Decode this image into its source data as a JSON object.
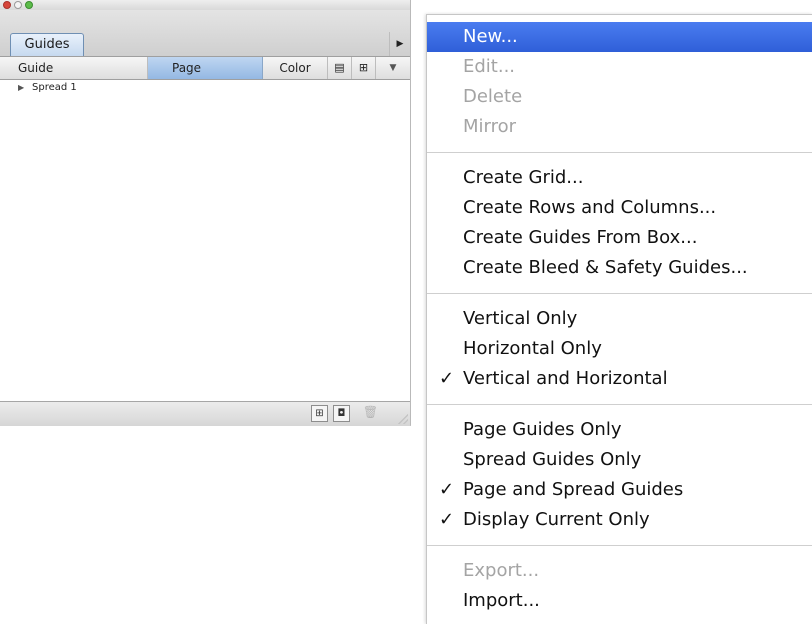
{
  "palette": {
    "tab_label": "Guides",
    "flyout_icon": "right-triangle-icon",
    "columns": {
      "guide": "Guide",
      "page": "Page",
      "color": "Color"
    },
    "column_icons": [
      "grid-lines-icon",
      "crosshair-grid-icon",
      "menu-triangle-icon"
    ],
    "tree": [
      {
        "label": "Spread 1"
      }
    ],
    "footer_buttons": [
      "new-guide-icon",
      "duplicate-icon",
      "trash-icon"
    ]
  },
  "menu": {
    "items": {
      "new": "New...",
      "edit": "Edit...",
      "delete": "Delete",
      "mirror": "Mirror",
      "create_grid": "Create Grid...",
      "create_rows_columns": "Create Rows and Columns...",
      "create_from_box": "Create Guides From Box...",
      "create_bleed_safety": "Create Bleed & Safety Guides...",
      "vertical_only": "Vertical Only",
      "horizontal_only": "Horizontal Only",
      "vertical_and_horizontal": "Vertical and Horizontal",
      "page_guides_only": "Page Guides Only",
      "spread_guides_only": "Spread Guides Only",
      "page_and_spread": "Page and Spread Guides",
      "display_current_only": "Display Current Only",
      "export": "Export...",
      "import": "Import..."
    },
    "check_glyph": "✓",
    "selected_color": "#3a6ae3"
  }
}
